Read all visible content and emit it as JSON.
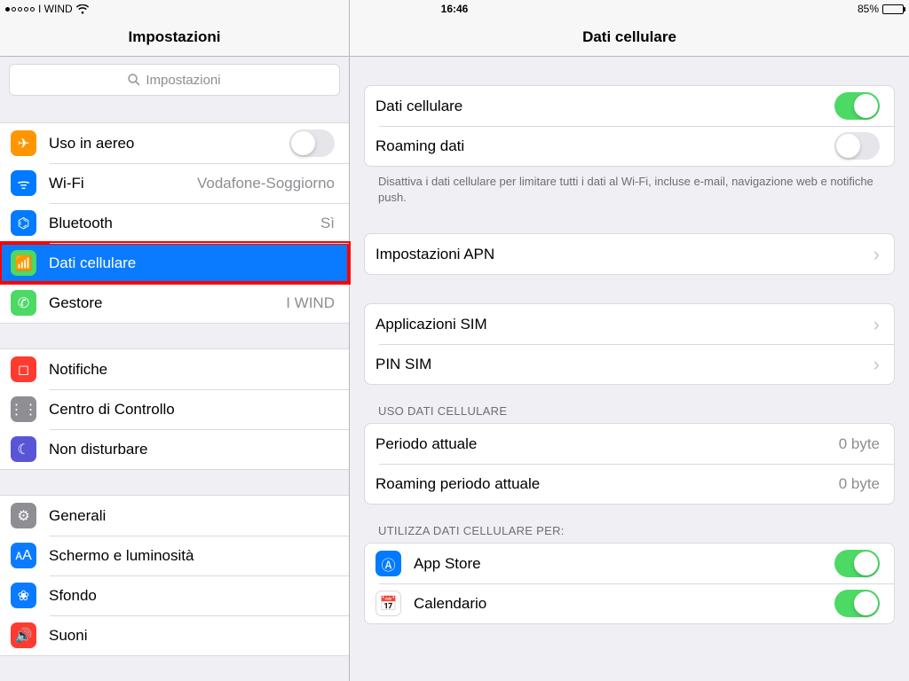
{
  "statusbar": {
    "carrier": "I WIND",
    "time": "16:46",
    "battery_pct": "85%"
  },
  "sidebar": {
    "title": "Impostazioni",
    "search_placeholder": "Impostazioni",
    "groups": [
      [
        {
          "id": "airplane",
          "label": "Uso in aereo",
          "kind": "switch",
          "on": false,
          "icon": "airplane-icon",
          "color": "c-orange"
        },
        {
          "id": "wifi",
          "label": "Wi-Fi",
          "kind": "link",
          "value": "Vodafone-Soggiorno",
          "icon": "wifi-icon",
          "color": "c-blue"
        },
        {
          "id": "bluetooth",
          "label": "Bluetooth",
          "kind": "link",
          "value": "Sì",
          "icon": "bluetooth-icon",
          "color": "c-blue"
        },
        {
          "id": "cellular",
          "label": "Dati cellulare",
          "kind": "link",
          "selected": true,
          "highlight": true,
          "icon": "cellular-icon",
          "color": "c-green"
        },
        {
          "id": "carrier",
          "label": "Gestore",
          "kind": "link",
          "value": "I WIND",
          "icon": "phone-icon",
          "color": "c-green"
        }
      ],
      [
        {
          "id": "notifications",
          "label": "Notifiche",
          "kind": "link",
          "icon": "notifications-icon",
          "color": "c-red"
        },
        {
          "id": "controlcenter",
          "label": "Centro di Controllo",
          "kind": "link",
          "icon": "controlcenter-icon",
          "color": "c-grey"
        },
        {
          "id": "dnd",
          "label": "Non disturbare",
          "kind": "link",
          "icon": "moon-icon",
          "color": "c-purple"
        }
      ],
      [
        {
          "id": "general",
          "label": "Generali",
          "kind": "link",
          "icon": "gear-icon",
          "color": "c-grey"
        },
        {
          "id": "display",
          "label": "Schermo e luminosità",
          "kind": "link",
          "icon": "display-icon",
          "color": "c-dblue"
        },
        {
          "id": "wallpaper",
          "label": "Sfondo",
          "kind": "link",
          "icon": "wallpaper-icon",
          "color": "c-dblue"
        },
        {
          "id": "sounds",
          "label": "Suoni",
          "kind": "link",
          "icon": "sounds-icon",
          "color": "c-red"
        }
      ]
    ]
  },
  "detail": {
    "title": "Dati cellulare",
    "g1": {
      "cell_data": {
        "label": "Dati cellulare",
        "on": true
      },
      "roaming": {
        "label": "Roaming dati",
        "on": false
      },
      "note": "Disattiva i dati cellulare per limitare tutti i dati al Wi-Fi, incluse e-mail, navigazione web e notifiche push."
    },
    "g2": {
      "apn": "Impostazioni APN"
    },
    "g3": {
      "sim_apps": "Applicazioni SIM",
      "sim_pin": "PIN SIM"
    },
    "usage": {
      "header": "Uso dati cellulare",
      "period": {
        "label": "Periodo attuale",
        "value": "0 byte"
      },
      "roam_period": {
        "label": "Roaming periodo attuale",
        "value": "0 byte"
      }
    },
    "per_app": {
      "header": "Utilizza dati cellulare per:",
      "apps": [
        {
          "id": "appstore",
          "label": "App Store",
          "on": true,
          "icon": "appstore-icon",
          "color": "c-blue"
        },
        {
          "id": "calendar",
          "label": "Calendario",
          "on": true,
          "icon": "calendar-icon",
          "color": "c-white"
        }
      ]
    }
  }
}
